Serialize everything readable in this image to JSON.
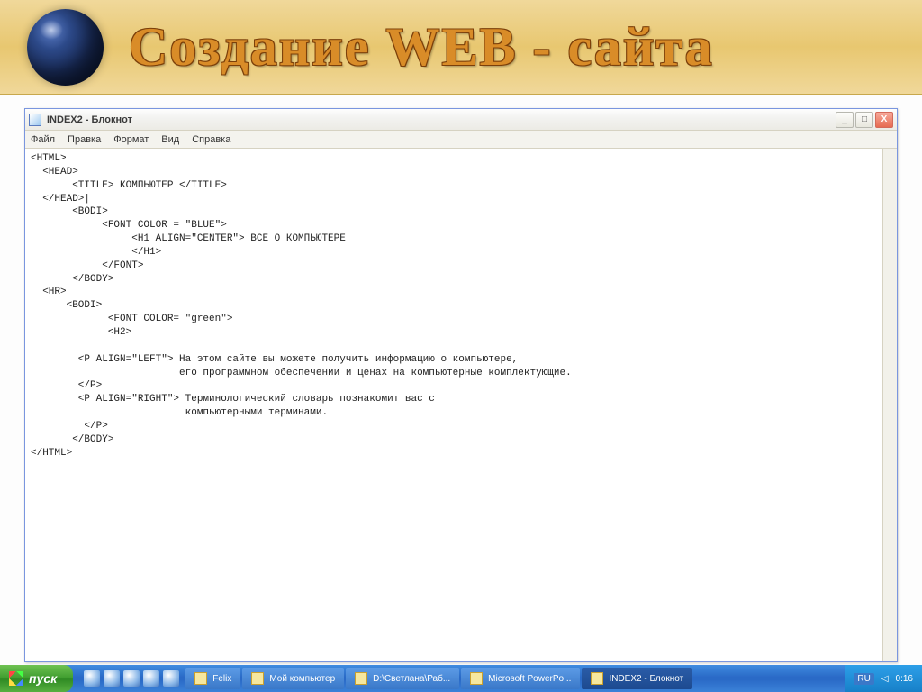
{
  "header": {
    "title": "Создание WEB - сайта"
  },
  "window": {
    "title": "INDEX2 - Блокнот",
    "controls": {
      "min": "_",
      "max": "□",
      "close": "X"
    }
  },
  "menubar": {
    "items": [
      "Файл",
      "Правка",
      "Формат",
      "Вид",
      "Справка"
    ]
  },
  "editor": {
    "text": "<HTML>\n  <HEAD>\n       <TITLE> КОМПЬЮТЕР </TITLE>\n  </HEAD>|\n       <BODI>\n            <FONT COLOR = \"BLUE\">\n                 <H1 ALIGN=\"CENTER\"> ВСЕ О КОМПЬЮТЕРЕ\n                 </H1>\n            </FONT>\n       </BODY>\n  <HR>\n      <BODI>\n             <FONT COLOR= \"green\">\n             <H2>\n\n        <P ALIGN=\"LEFT\"> На этом сайте вы можете получить информацию о компьютере,\n                         его программном обеспечении и ценах на компьютерные комплектующие.\n        </P>\n        <P ALIGN=\"RIGHT\"> Терминологический словарь познакомит вас с\n                          компьютерными терминами.\n         </P>\n       </BODY>\n</HTML>"
  },
  "taskbar": {
    "start": "пуск",
    "items": [
      {
        "label": "Felix"
      },
      {
        "label": "Мой компьютер"
      },
      {
        "label": "D:\\Светлана\\Раб..."
      },
      {
        "label": "Microsoft PowerPo..."
      },
      {
        "label": "INDEX2 - Блокнот"
      }
    ],
    "lang": "RU",
    "time": "0:16"
  }
}
